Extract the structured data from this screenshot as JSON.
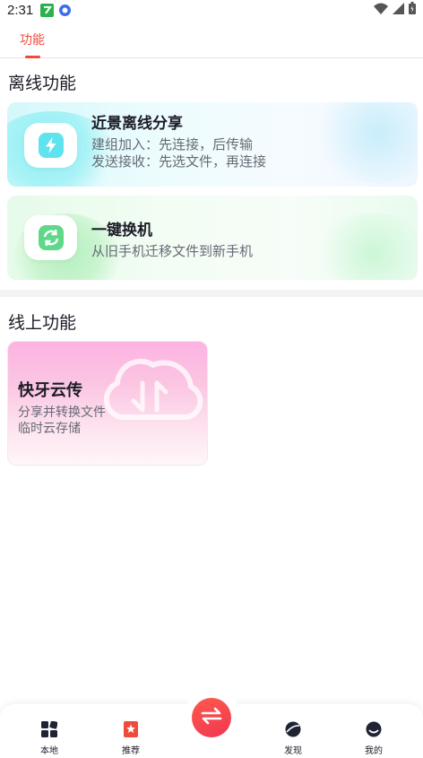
{
  "status_bar": {
    "time": "2:31"
  },
  "top_tabs": [
    {
      "label": "功能",
      "active": true
    }
  ],
  "offline_section": {
    "title": "离线功能",
    "cards": [
      {
        "title": "近景离线分享",
        "lines": [
          "建组加入：先连接，后传输",
          "发送接收：先选文件，再连接"
        ],
        "icon": "lightning-icon"
      },
      {
        "title": "一键换机",
        "lines": [
          "从旧手机迁移文件到新手机"
        ],
        "icon": "refresh-icon"
      }
    ]
  },
  "online_section": {
    "title": "线上功能",
    "cards": [
      {
        "title": "快牙云传",
        "lines": [
          "分享并转换文件",
          "临时云存储"
        ],
        "icon": "cloud-transfer-icon"
      }
    ]
  },
  "bottom_nav": {
    "items": [
      {
        "label": "本地",
        "icon": "grid-icon"
      },
      {
        "label": "推荐",
        "icon": "bookmark-star-icon"
      },
      {
        "label": "发现",
        "icon": "planet-icon"
      },
      {
        "label": "我的",
        "icon": "profile-icon"
      }
    ],
    "center_action_icon": "transfer-arrows-icon"
  },
  "colors": {
    "accent": "#f04a3c",
    "offline_icon": "#5fe3ee",
    "switch_icon": "#5fd88a"
  }
}
